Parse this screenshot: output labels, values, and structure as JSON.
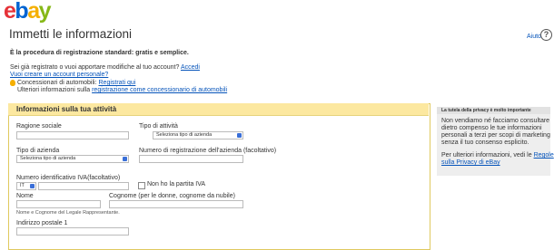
{
  "header": {
    "logo": {
      "e": "e",
      "b": "b",
      "a": "a",
      "y": "y"
    },
    "title": "Immetti le informazioni",
    "help_label": "Aiuto",
    "help_icon": "?"
  },
  "intro": {
    "standard": "È la procedura di registrazione standard: gratis e semplice.",
    "registered_q": "Sei già registrato o vuoi apportare modifiche al tuo account?",
    "login_link": "Accedi",
    "personal_link": "Vuoi creare un account personale?",
    "dealers_label": "Concessionari di automobili:",
    "dealers_link": "Registrati qui",
    "more_info": "Ulteriori informazioni sulla",
    "more_info_link": "registrazione come concessionario di automobili"
  },
  "form": {
    "section_title": "Informazioni sulla tua attività",
    "ragione_label": "Ragione sociale",
    "tipo_attivita_label": "Tipo di attività",
    "tipo_attivita_value": "Seleziona tipo di azienda",
    "tipo_azienda_label": "Tipo di azienda",
    "tipo_azienda_value": "Seleziona tipo di azienda",
    "numero_reg_label": "Numero di registrazione dell'azienda (facoltativo)",
    "iva_label": "Numero identificativo IVA(facoltativo)",
    "iva_country": "IT",
    "no_iva_label": "Non ho la partita IVA",
    "nome_label": "Nome",
    "cognome_label": "Cognome (per le donne, cognome da nubile)",
    "legal_rep_note": "Nome e Cognome del Legale Rappresentante.",
    "indirizzo_label": "Indirizzo postale 1"
  },
  "privacy": {
    "heading": "La tutela della privacy è molto importante",
    "body": [
      "Non vendiamo né facciamo consultare",
      "dietro compenso le tue informazioni",
      "personali a terzi per scopi di marketing",
      "senza il tuo consenso esplicito."
    ],
    "more_prefix": "Per ulteriori informazioni, vedi le",
    "rules_link_1": "Regole",
    "rules_link_2": "sulla Privacy di eBay"
  },
  "colors": {
    "accent": "#0654ba",
    "section_header": "#fce8a0",
    "sidebar": "#eeeeee"
  }
}
